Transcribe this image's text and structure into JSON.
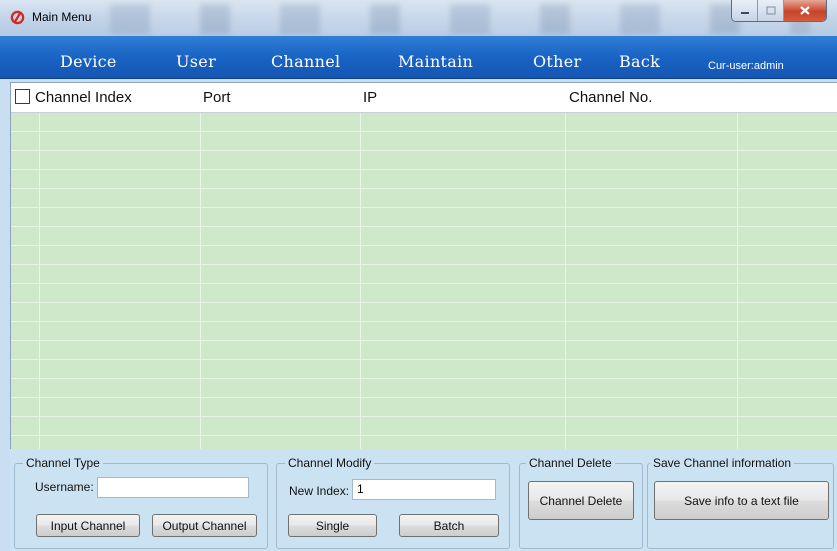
{
  "window": {
    "title": "Main Menu",
    "controls": [
      "minimize",
      "maximize",
      "close"
    ]
  },
  "menu": {
    "items": [
      "Device",
      "User",
      "Channel",
      "Maintain",
      "Other",
      "Back"
    ],
    "current_user": "Cur-user:admin"
  },
  "table": {
    "columns": [
      "Channel Index",
      "Port",
      "IP",
      "Channel No."
    ],
    "rows": []
  },
  "channel_type": {
    "title": "Channel Type",
    "username_label": "Username:",
    "username_value": "",
    "input_button": "Input Channel",
    "output_button": "Output Channel"
  },
  "channel_modify": {
    "title": "Channel Modify",
    "new_index_label": "New Index:",
    "new_index_value": "1",
    "single_button": "Single",
    "batch_button": "Batch"
  },
  "channel_delete": {
    "title": "Channel Delete",
    "button": "Channel Delete"
  },
  "save_info": {
    "title": "Save Channel information",
    "button": "Save info to a text file"
  },
  "colors": {
    "menubar": "#1a63c4",
    "table_body": "#cfe8c9",
    "panel": "#cbe2f2",
    "close_button": "#c9432a"
  }
}
